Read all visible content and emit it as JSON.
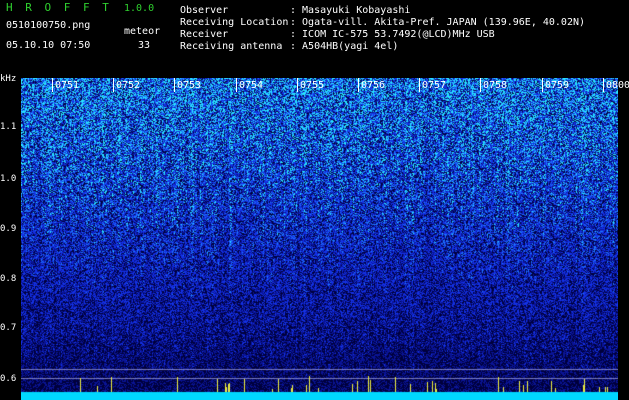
{
  "header": {
    "app_name": "H R O F F T",
    "version": "1.0.0",
    "filename": "0510100750.png",
    "datetime": "05.10.10 07:50",
    "meteor_label": "meteor",
    "meteor_count": "33",
    "fields": [
      {
        "label": "Observer",
        "value": ": Masayuki Kobayashi"
      },
      {
        "label": "Receiving Location",
        "value": ": Ogata-vill. Akita-Pref. JAPAN (139.96E, 40.02N)"
      },
      {
        "label": "Receiver",
        "value": ": ICOM IC-575 53.7492(@LCD)MHz USB"
      },
      {
        "label": "Receiving antenna",
        "value": ": A504HB(yagi 4el)"
      }
    ]
  },
  "spectrogram": {
    "y_unit": "kHz",
    "y_ticks": [
      "1.1",
      "1.0",
      "0.9",
      "0.8",
      "0.7",
      "0.6"
    ],
    "time_labels": [
      "0751",
      "0752",
      "0753",
      "0754",
      "0755",
      "0756",
      "0757",
      "0758",
      "0759",
      "0800"
    ],
    "colors": {
      "background": "#00003a",
      "noise": "#1a3cff",
      "signal": "#2ee0ff",
      "baseline": "#00e5ff"
    }
  }
}
